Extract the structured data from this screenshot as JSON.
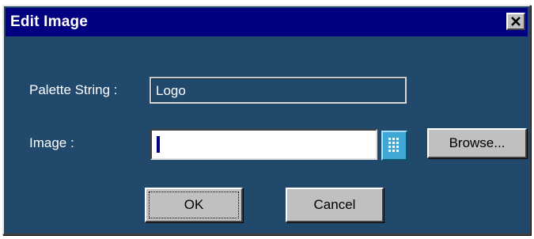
{
  "window": {
    "title": "Edit Image",
    "close_glyph": "×"
  },
  "form": {
    "palette_label": "Palette String :",
    "palette_value": "Logo",
    "image_label": "Image :",
    "image_value": "",
    "grid_icon": "grid-icon"
  },
  "buttons": {
    "browse": "Browse...",
    "ok": "OK",
    "cancel": "Cancel"
  },
  "colors": {
    "titlebar": "#000080",
    "dialog_bg": "#21496b",
    "button_face": "#c0c0c0",
    "grid_button": "#3ea7d6"
  }
}
